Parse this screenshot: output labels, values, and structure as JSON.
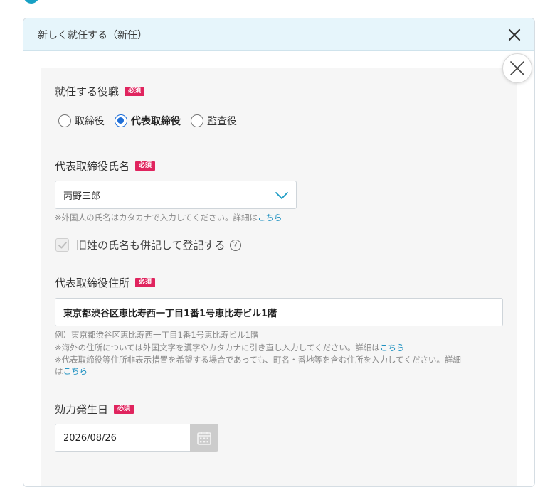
{
  "dialog": {
    "title": "新しく就任する（新任）"
  },
  "role_section": {
    "label": "就任する役職",
    "required": "必須",
    "options": [
      {
        "label": "取締役",
        "checked": false
      },
      {
        "label": "代表取締役",
        "checked": true
      },
      {
        "label": "監査役",
        "checked": false
      }
    ]
  },
  "name_section": {
    "label": "代表取締役氏名",
    "required": "必須",
    "value": "丙野三郎",
    "note_text": "※外国人の氏名はカタカナで入力してください。詳細は",
    "note_link": "こちら"
  },
  "maiden_name": {
    "label": "旧姓の氏名も併記して登記する",
    "help": "?"
  },
  "address_section": {
    "label": "代表取締役住所",
    "required": "必須",
    "value": "東京都渋谷区恵比寿西一丁目1番1号恵比寿ビル1階",
    "note1": "例）東京都渋谷区恵比寿西一丁目1番1号恵比寿ビル1階",
    "note2_text": "※海外の住所については外国文字を漢字やカタカナに引き直し入力してください。詳細は",
    "note2_link": "こちら",
    "note3_text": "※代表取締役等住所非表示措置を希望する場合であっても、町名・番地等を含む住所を入力してください。詳細",
    "note3b_text": "は",
    "note3_link": "こちら"
  },
  "date_section": {
    "label": "効力発生日",
    "required": "必須",
    "value": "2026/08/26"
  },
  "colors": {
    "accent": "#17a0c4",
    "required_badge": "#e0245e",
    "link": "#1a8fc0",
    "radio_checked": "#1f6fd8"
  }
}
